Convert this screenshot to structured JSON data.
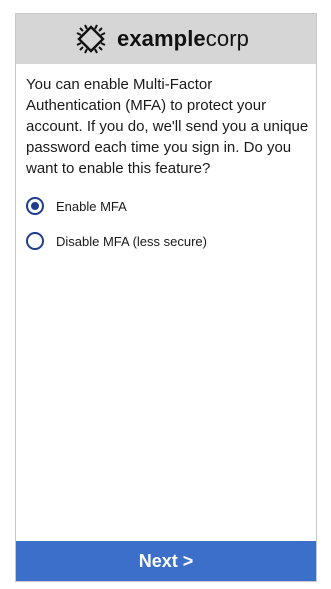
{
  "header": {
    "brand_bold": "example",
    "brand_light": "corp",
    "logo_icon": "chip-icon"
  },
  "main": {
    "intro_text": "You can enable Multi-Factor Authentication (MFA) to protect your account. If you do, we'll send you a unique password each time you sign in. Do you want to enable this feature?",
    "options": [
      {
        "label": "Enable MFA",
        "selected": true
      },
      {
        "label": "Disable MFA (less secure)",
        "selected": false
      }
    ]
  },
  "footer": {
    "next_label": "Next >"
  },
  "colors": {
    "header_bg": "#d6d6d6",
    "accent": "#1f3d8c",
    "button_bg": "#3b6fc9"
  }
}
